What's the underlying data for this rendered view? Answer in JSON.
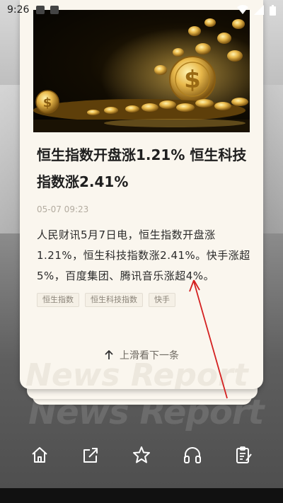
{
  "status_bar": {
    "time": "9:26"
  },
  "article": {
    "headline": "恒生指数开盘涨1.21% 恒生科技指数涨2.41%",
    "date": "05-07 09:23",
    "body": "人民财讯5月7日电，恒生指数开盘涨1.21%，恒生科技指数涨2.41%。快手涨超5%，百度集团、腾讯音乐涨超4%。",
    "tags": [
      "恒生指数",
      "恒生科技指数",
      "快手"
    ]
  },
  "swipe_hint": "上滑看下一条",
  "watermark": "News Report",
  "toolbar": {
    "items": [
      {
        "icon": "home-icon"
      },
      {
        "icon": "share-icon"
      },
      {
        "icon": "star-icon"
      },
      {
        "icon": "headphones-icon"
      },
      {
        "icon": "notes-icon"
      }
    ]
  },
  "colors": {
    "card_bg": "#faf6ee",
    "annotation_red": "#d42020",
    "gold": "#d4a640"
  }
}
